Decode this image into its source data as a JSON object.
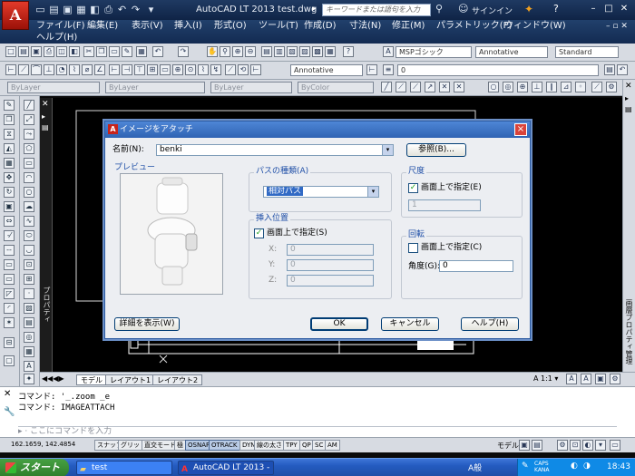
{
  "app": {
    "logo_letter": "A",
    "title": "AutoCAD LT 2013   test.dwg",
    "search_placeholder": "キーワードまたは語句を入力",
    "signin": "サインイン",
    "help_icon_text": "?"
  },
  "menu": {
    "items": [
      "ファイル(F)",
      "編集(E)",
      "表示(V)",
      "挿入(I)",
      "形式(O)",
      "ツール(T)",
      "作成(D)",
      "寸法(N)",
      "修正(M)",
      "パラメトリック(P)",
      "ウィンドウ(W)"
    ],
    "second_row": [
      "ヘルプ(H)"
    ]
  },
  "toolbars": {
    "text_style": "MSPゴシック",
    "annotative_1": "Annotative",
    "dim_style": "Standard",
    "annotative_2": "Annotative",
    "layer_value": "0",
    "color": "ByLayer",
    "linetype": "ByLayer",
    "lineweight": "ByLayer",
    "plotstyle": "ByColor"
  },
  "left_palette": {
    "label": "プロパティ"
  },
  "right_palette": {
    "label": "画層プロパティ管理"
  },
  "drawing": {
    "axis_x": "X"
  },
  "layout_tabs": [
    "モデル",
    "レイアウト1",
    "レイアウト2"
  ],
  "view_controls": {
    "scale": "1:1"
  },
  "command": {
    "history": [
      "コマンド:  '_.zoom _e",
      "コマンド:  IMAGEATTACH"
    ],
    "prompt": "ここにコマンドを入力"
  },
  "status": {
    "coords": "162.1659, 142.4854",
    "toggles": [
      "スナップ",
      "グリッド",
      "直交モード",
      "極",
      "OSNAP",
      "OTRACK",
      "DYN",
      "線の太さ",
      "TPY",
      "QP",
      "SC",
      "AM"
    ],
    "active_toggles": [
      "OSNAP",
      "OTRACK"
    ],
    "model_label": "モデル"
  },
  "taskbar": {
    "start": "スタート",
    "tasks": [
      {
        "label": "test",
        "active": false
      },
      {
        "label": "AutoCAD LT 2013 - ...",
        "active": true
      }
    ],
    "ime": "A般",
    "caps": "CAPS KANA",
    "clock": "18:43"
  },
  "dialog": {
    "title": "イメージをアタッチ",
    "name_label": "名前(N):",
    "name_value": "benki",
    "browse_button": "参照(B)...",
    "preview_label": "プレビュー",
    "path_type_label": "パスの種類(A)",
    "path_type_value": "相対パス",
    "insert_point_label": "挿入位置",
    "insert_onscreen": "画面上で指定(S)",
    "x_label": "X:",
    "x_value": "0",
    "y_label": "Y:",
    "y_value": "0",
    "z_label": "Z:",
    "z_value": "0",
    "scale_label": "尺度",
    "scale_onscreen": "画面上で指定(E)",
    "scale_value": "1",
    "rotation_label": "回転",
    "rotation_onscreen": "画面上で指定(C)",
    "angle_label": "角度(G):",
    "angle_value": "0",
    "details_button": "詳細を表示(W)",
    "ok_button": "OK",
    "cancel_button": "キャンセル",
    "help_button": "ヘルプ(H)",
    "close_glyph": "×"
  }
}
